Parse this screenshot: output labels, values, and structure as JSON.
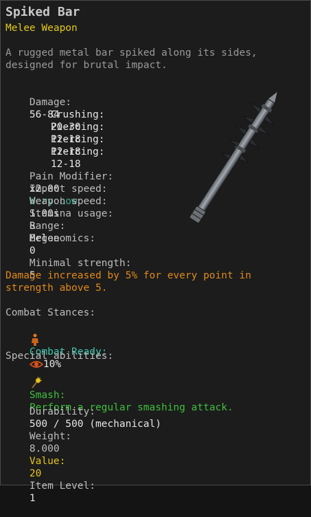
{
  "item": {
    "name": "Spiked Bar",
    "type": "Melee Weapon",
    "description_line1": "A rugged metal bar spiked along its sides,",
    "description_line2": "designed for brutal impact.",
    "icon": "spiked-bar-weapon-icon"
  },
  "damage": {
    "label": "Damage:",
    "value": "56-84",
    "components": [
      {
        "label": "Crushing:",
        "value": "20-30"
      },
      {
        "label": "Piercing:",
        "value": "12-18"
      },
      {
        "label": "Piercing:",
        "value": "12-18"
      },
      {
        "label": "Piercing:",
        "value": "12-18"
      }
    ]
  },
  "stats": {
    "pain_modifier": {
      "label": "Pain Modifier:",
      "value": "x2.00"
    },
    "impact_speed": {
      "label": "Impact speed:",
      "value": "Very Low"
    },
    "weapon_speed": {
      "label": "Weapon speed:",
      "value": "1.00s"
    },
    "stamina_usage": {
      "label": "Stamina usage:",
      "value": "8"
    },
    "range": {
      "label": "Range:",
      "value": "Melee"
    },
    "ergonomics": {
      "label": "Ergonomics:",
      "value": "0"
    }
  },
  "requirements": {
    "minimal_strength": {
      "label": "Minimal strength:",
      "value": "5"
    },
    "bonus_line1": "Damage increased by 5% for every point in",
    "bonus_line2": "strength above 5."
  },
  "combat": {
    "header": "Combat Stances:",
    "stance_name": "Combat Ready:",
    "stance_value": "10%",
    "stance_icon": "figure-icon",
    "stance_stat_icon": "eye-icon"
  },
  "abilities": {
    "header": "Special abilities:",
    "name": "Smash:",
    "description": "Perform a regular smashing attack.",
    "icon": "mace-icon"
  },
  "durability": {
    "label": "Durability:",
    "value": "500 / 500 (mechanical)"
  },
  "weight": {
    "label": "Weight:",
    "value": "8.000"
  },
  "value": {
    "label": "Value:",
    "value": "20"
  },
  "item_level": {
    "label": "Item Level:",
    "value": "1"
  },
  "colors": {
    "title": "#c8c8c8",
    "subtitle": "#e4c817",
    "teal": "#3ec6b0",
    "orange": "#e08a1a",
    "green": "#3fbf3f",
    "yellow": "#e8c51a"
  }
}
